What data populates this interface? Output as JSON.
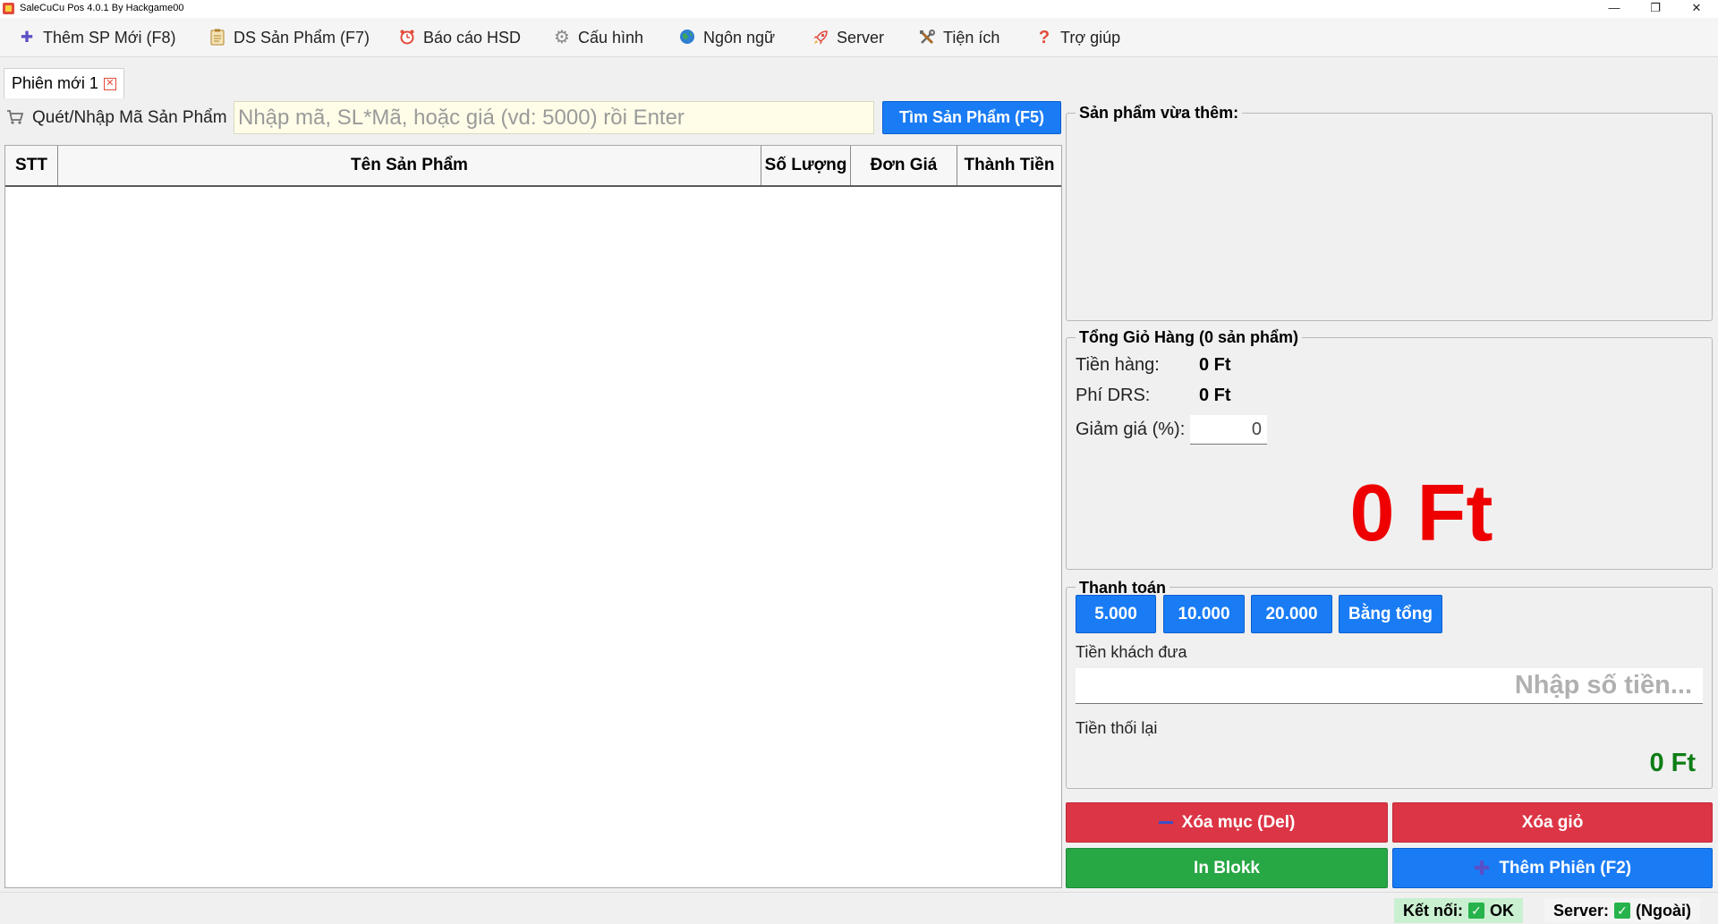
{
  "window": {
    "title": "SaleCuCu Pos 4.0.1 By Hackgame00",
    "minimize": "—",
    "restore": "❐",
    "close": "✕"
  },
  "menu": [
    {
      "label": "Thêm SP Mới (F8)",
      "icon": "plus-icon",
      "glyph": "✚",
      "color": "#5b4fc7"
    },
    {
      "label": "DS Sản Phẩm (F7)",
      "icon": "clipboard-icon",
      "glyph": "📋",
      "color": "#c98a2a"
    },
    {
      "label": "Báo cáo HSD",
      "icon": "alarm-clock-icon",
      "glyph": "⏰",
      "color": "#e24a3b"
    },
    {
      "label": "Cấu hình",
      "icon": "gear-icon",
      "glyph": "⚙",
      "color": "#7a7a7a"
    },
    {
      "label": "Ngôn ngữ",
      "icon": "globe-icon",
      "glyph": "●",
      "color": "#2a8c5a"
    },
    {
      "label": "Server",
      "icon": "rocket-icon",
      "glyph": "🚀",
      "color": "#e24a3b"
    },
    {
      "label": "Tiện ích",
      "icon": "tools-icon",
      "glyph": "🛠",
      "color": "#6a6a6a"
    },
    {
      "label": "Trợ giúp",
      "icon": "question-icon",
      "glyph": "?",
      "color": "#e24a3b"
    }
  ],
  "tab": {
    "label": "Phiên mới 1",
    "close": "✕"
  },
  "scan": {
    "label": "Quét/Nhập Mã Sản Phẩm",
    "placeholder": "Nhập mã, SL*Mã, hoặc giá (vd: 5000) rồi Enter",
    "find_button": "Tìm Sản Phẩm (F5)"
  },
  "table": {
    "columns": [
      "STT",
      "Tên Sản Phẩm",
      "Số Lượng",
      "Đơn Giá",
      "Thành Tiền"
    ],
    "rows": []
  },
  "recent": {
    "title": "Sản phẩm vừa thêm:"
  },
  "cart": {
    "title": "Tổng Giỏ Hàng (0 sản phẩm)",
    "subtotal_label": "Tiền hàng:",
    "subtotal_value": "0 Ft",
    "drs_label": "Phí DRS:",
    "drs_value": "0 Ft",
    "discount_label": "Giảm giá (%):",
    "discount_value": "0",
    "grand_total": "0 Ft"
  },
  "payment": {
    "title": "Thanh toán",
    "quick_buttons": [
      "5.000",
      "10.000",
      "20.000",
      "Bằng tổng"
    ],
    "given_label": "Tiền khách đưa",
    "given_placeholder": "Nhập số tiền...",
    "change_label": "Tiền thối lại",
    "change_value": "0 Ft"
  },
  "actions": {
    "delete_item": "Xóa mục (Del)",
    "clear_cart": "Xóa giỏ",
    "print": "In Blokk",
    "new_session": "Thêm Phiên (F2)"
  },
  "status": {
    "connection_label": "Kết nối:",
    "connection_value": "OK",
    "server_label": "Server:",
    "server_value": "(Ngoài)"
  }
}
